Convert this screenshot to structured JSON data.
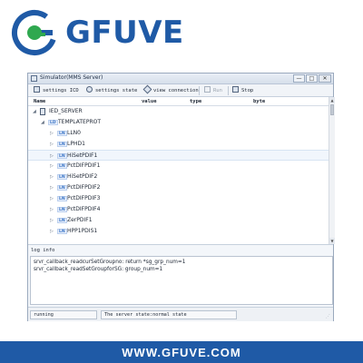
{
  "brand": {
    "name": "GFUVE",
    "color": "#1f5aa6",
    "logo_icon": "gfuve-logo-icon"
  },
  "window": {
    "title": "Simulator(MMS Server)",
    "controls": {
      "minimize": "—",
      "maximize": "□",
      "close": "✕"
    }
  },
  "toolbar": {
    "settings_icd": "settings ICD",
    "settings_state": "settings  state",
    "view_connection": "view connection",
    "run": "Run",
    "stop": "Stop"
  },
  "columns": {
    "name": "Name",
    "value": "value",
    "type": "type",
    "byte": "byte"
  },
  "tree": {
    "server": {
      "label": "IED_SERVER",
      "toggle": "◢"
    },
    "ld": {
      "badge": "LD",
      "label": "TEMPLATEPROT",
      "toggle": "◢"
    },
    "nodes": [
      {
        "badge": "LN",
        "label": "LLN0",
        "toggle": "▷"
      },
      {
        "badge": "LN",
        "label": "LPHD1",
        "toggle": "▷"
      },
      {
        "badge": "LN",
        "label": "HiSetPDIF1",
        "toggle": "▷"
      },
      {
        "badge": "LN",
        "label": "PctDIFPDIF1",
        "toggle": "▷"
      },
      {
        "badge": "LN",
        "label": "HiSetPDIF2",
        "toggle": "▷"
      },
      {
        "badge": "LN",
        "label": "PctDIFPDIF2",
        "toggle": "▷"
      },
      {
        "badge": "LN",
        "label": "PctDIFPDIF3",
        "toggle": "▷"
      },
      {
        "badge": "LN",
        "label": "PctDIFPDIF4",
        "toggle": "▷"
      },
      {
        "badge": "LN",
        "label": "ZerPDIF1",
        "toggle": "▷"
      },
      {
        "badge": "LN",
        "label": "HPP1PDIS1",
        "toggle": "▷"
      }
    ],
    "selected_index": 2
  },
  "log": {
    "label": "log info",
    "lines": [
      "srvr_callback_readcurSetGroupno: return *sg_grp_num=1",
      "srvr_callback_readSetGroupforSG: group_num=1"
    ]
  },
  "status": {
    "state": "running",
    "message": "The server state:normal state"
  },
  "footer": {
    "url": "WWW.GFUVE.COM",
    "color": "#1f5aa6"
  }
}
